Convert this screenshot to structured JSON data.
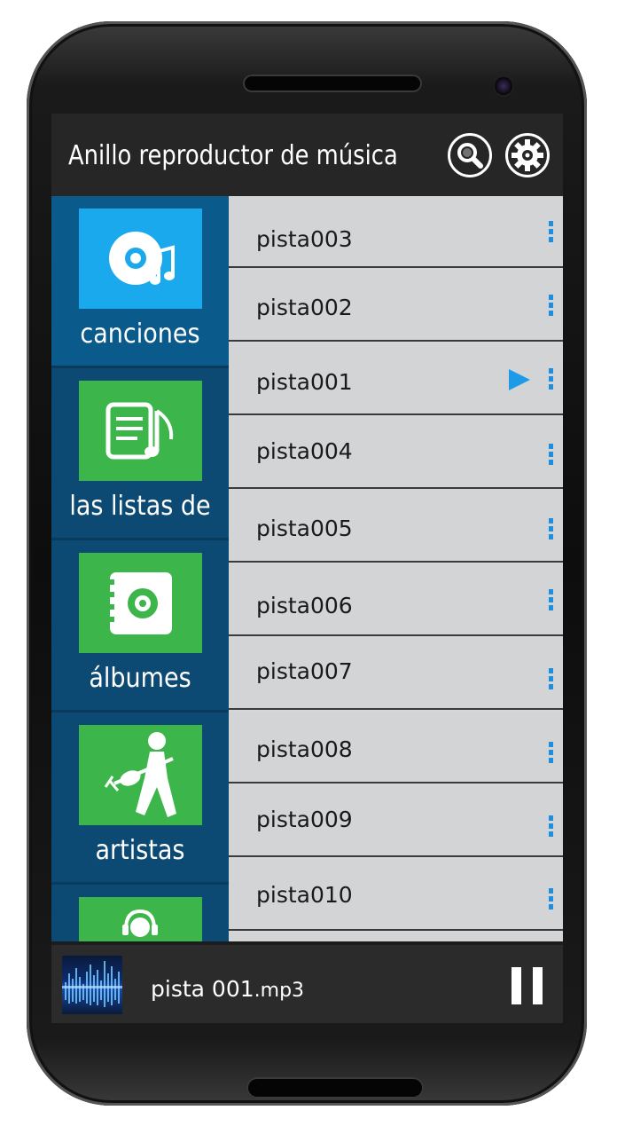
{
  "app": {
    "title": "Anillo reproductor de música"
  },
  "header": {
    "search_icon": "search-icon",
    "settings_icon": "gear-icon"
  },
  "nav": {
    "items": [
      {
        "label": "canciones",
        "icon": "music-disc-icon",
        "tile_color": "#1aa9ec",
        "active": true
      },
      {
        "label": "las listas de",
        "icon": "playlist-icon",
        "tile_color": "#3cb54a"
      },
      {
        "label": "álbumes",
        "icon": "album-icon",
        "tile_color": "#3cb54a"
      },
      {
        "label": "artistas",
        "icon": "artist-guitar-icon",
        "tile_color": "#3cb54a"
      },
      {
        "label": "",
        "icon": "headphones-person-icon",
        "tile_color": "#3cb54a"
      }
    ]
  },
  "tracks": [
    {
      "name": "pista003"
    },
    {
      "name": "pista002"
    },
    {
      "name": "pista001",
      "playing": true
    },
    {
      "name": "pista004"
    },
    {
      "name": "pista005"
    },
    {
      "name": "pista006"
    },
    {
      "name": "pista007"
    },
    {
      "name": "pista008"
    },
    {
      "name": "pista009"
    },
    {
      "name": "pista010"
    }
  ],
  "player": {
    "title_main": "pista 001",
    "title_ext": ".mp3",
    "pause_icon": "pause-icon"
  },
  "colors": {
    "accent_blue": "#1e8fe0",
    "nav_bg": "#0c4a73",
    "list_bg": "#d3d4d6",
    "green_tile": "#3cb54a",
    "blue_tile": "#1aa9ec"
  }
}
